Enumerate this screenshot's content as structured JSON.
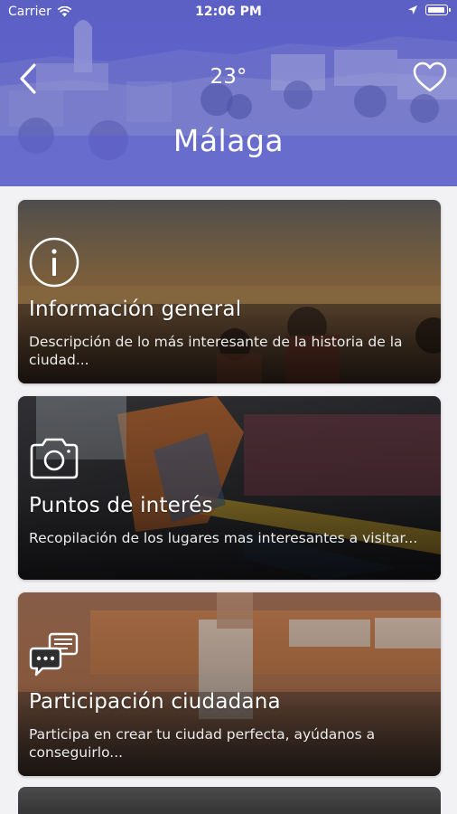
{
  "status_bar": {
    "carrier": "Carrier",
    "time": "12:06 PM"
  },
  "header": {
    "temperature": "23°",
    "city": "Málaga",
    "accent_color": "#5a5fc9"
  },
  "cards": [
    {
      "icon": "info-icon",
      "title": "Información general",
      "description": "Descripción de lo más interesante de la historia de la ciudad..."
    },
    {
      "icon": "camera-icon",
      "title": "Puntos de interés",
      "description": "Recopilación de los lugares mas interesantes a visitar..."
    },
    {
      "icon": "chat-bubbles-icon",
      "title": "Participación ciudadana",
      "description": "Participa en crear tu ciudad perfecta, ayúdanos a conseguirlo..."
    }
  ]
}
